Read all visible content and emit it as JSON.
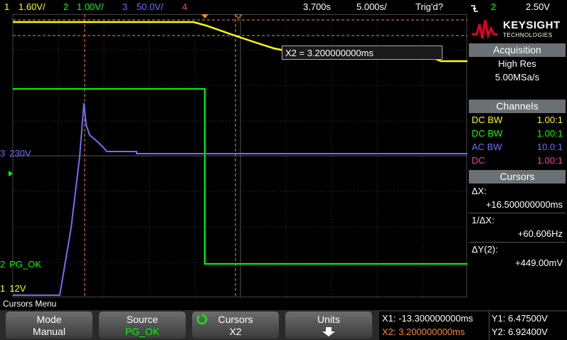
{
  "topbar": {
    "ch1_num": "1",
    "ch1_scale": "1.60V/",
    "ch2_num": "2",
    "ch2_scale": "1.00V/",
    "ch3_num": "3",
    "ch3_scale": "50.0V/",
    "ch4_num": "4",
    "time_pos": "3.700s",
    "time_scale": "5.000s/",
    "trigger_status": "Trig'd?",
    "trigger_icon": "falling-edge-icon",
    "trigger_source": "2",
    "trigger_level": "2.50V"
  },
  "screen": {
    "cursor_readout": "X2 = 3.200000000ms",
    "markers": {
      "ch3": "3",
      "ch3_level": "230V",
      "ch2": "2",
      "ch2_label": "PG_OK",
      "ch1": "1",
      "ch1_label": "12V"
    }
  },
  "panel": {
    "brand": "KEYSIGHT",
    "brand_sub": "TECHNOLOGIES",
    "acquisition_title": "Acquisition",
    "acq_mode": "High Res",
    "acq_rate": "5.00MSa/s",
    "channels_title": "Channels",
    "channels": [
      {
        "coupling": "DC BW",
        "probe": "1.00:1",
        "color": "#ffff00"
      },
      {
        "coupling": "DC BW",
        "probe": "1.00:1",
        "color": "#00ff00"
      },
      {
        "coupling": "AC BW",
        "probe": "10.0:1",
        "color": "#6e6eff"
      },
      {
        "coupling": "DC",
        "probe": "1.00:1",
        "color": "#ff3ab0"
      }
    ],
    "cursors_title": "Cursors",
    "delta_x_label": "ΔX:",
    "delta_x_value": "+16.500000000ms",
    "inv_delta_x_label": "1/ΔX:",
    "inv_delta_x_value": "+60.606Hz",
    "delta_y_label": "ΔY(2):",
    "delta_y_value": "+449.00mV"
  },
  "menu": {
    "title": "Cursors Menu",
    "keys": [
      {
        "title": "Mode",
        "value": "Manual"
      },
      {
        "title": "Source",
        "value": "PG_OK"
      },
      {
        "title": "Cursors",
        "value": "X2"
      },
      {
        "title": "Units",
        "value": ""
      }
    ]
  },
  "readout": {
    "x1": "X1: -13.300000000ms",
    "x2": "X2: 3.200000000ms",
    "y1": "Y1: 6.47500V",
    "y2": "Y2: 6.92400V"
  },
  "colors": {
    "ch1": "#ffff00",
    "ch2": "#00ff00",
    "ch3": "#6e6eff",
    "ch4": "#ff3ab0",
    "cursor": "#ff8c1a",
    "panel_header": "#6a7073"
  }
}
